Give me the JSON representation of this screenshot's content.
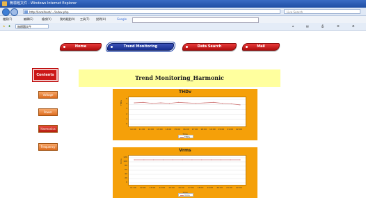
{
  "browser": {
    "window_title": "無標題文件 - Windows Internet Explorer",
    "url": "http://localhost/.../index.php",
    "search_placeholder": "Live Search",
    "menu": [
      "檔案(F)",
      "編輯(E)",
      "檢視(V)",
      "我的最愛(A)",
      "工具(T)",
      "說明(H)"
    ],
    "google_label": "Google",
    "tab_title": "無標題文件"
  },
  "nav_tabs": [
    {
      "label": "Home",
      "active": false
    },
    {
      "label": "Trend Monitoring",
      "active": true
    },
    {
      "label": "Data Search",
      "active": false
    },
    {
      "label": "Mail",
      "active": false
    }
  ],
  "side_buttons": [
    "Contents",
    "Voltage",
    "Power",
    "Harmonics",
    "Frequency"
  ],
  "banner_title": "Trend Monitoring_Harmonic",
  "charts_text": {
    "thdv": {
      "title": "THDv",
      "ylabel": "THDv",
      "xlabel": "Time",
      "legend": "THDv"
    },
    "vrms": {
      "title": "Vrms",
      "ylabel": "Vrms",
      "xlabel": "Time",
      "legend": "Vrms"
    }
  },
  "chart_data": [
    {
      "type": "line",
      "title": "THDv",
      "ylabel": "THDv",
      "xlabel": "Time",
      "categories": [
        "10:00",
        "11:00",
        "12:00",
        "13:00",
        "14:00",
        "15:00",
        "16:00",
        "17:00",
        "18:00",
        "19:00",
        "20:00",
        "21:00",
        "22:00"
      ],
      "ylim": [
        0,
        5
      ],
      "yticks": [
        0,
        1,
        2,
        3,
        4,
        5
      ],
      "series": [
        {
          "name": "THDv",
          "values": [
            4.3,
            4.4,
            4.2,
            4.3,
            4.2,
            4.4,
            4.3,
            4.2,
            4.3,
            4.4,
            4.2,
            4.1,
            3.9
          ]
        }
      ],
      "line_color": "#d07a7a"
    },
    {
      "type": "line",
      "title": "Vrms",
      "ylabel": "Vrms",
      "xlabel": "Time",
      "categories": [
        "11:00",
        "12:00",
        "13:00",
        "14:00",
        "15:00",
        "16:00",
        "17:00",
        "18:00",
        "19:00",
        "20:00",
        "21:00",
        "22:00"
      ],
      "ylim": [
        0,
        120
      ],
      "yticks": [
        0,
        20,
        40,
        60,
        80,
        100,
        120
      ],
      "series": [
        {
          "name": "Vrms",
          "values": [
            110,
            110,
            110,
            110,
            110,
            110,
            110,
            110,
            110,
            110,
            110,
            110
          ]
        }
      ],
      "line_color": "#d07a7a"
    }
  ]
}
